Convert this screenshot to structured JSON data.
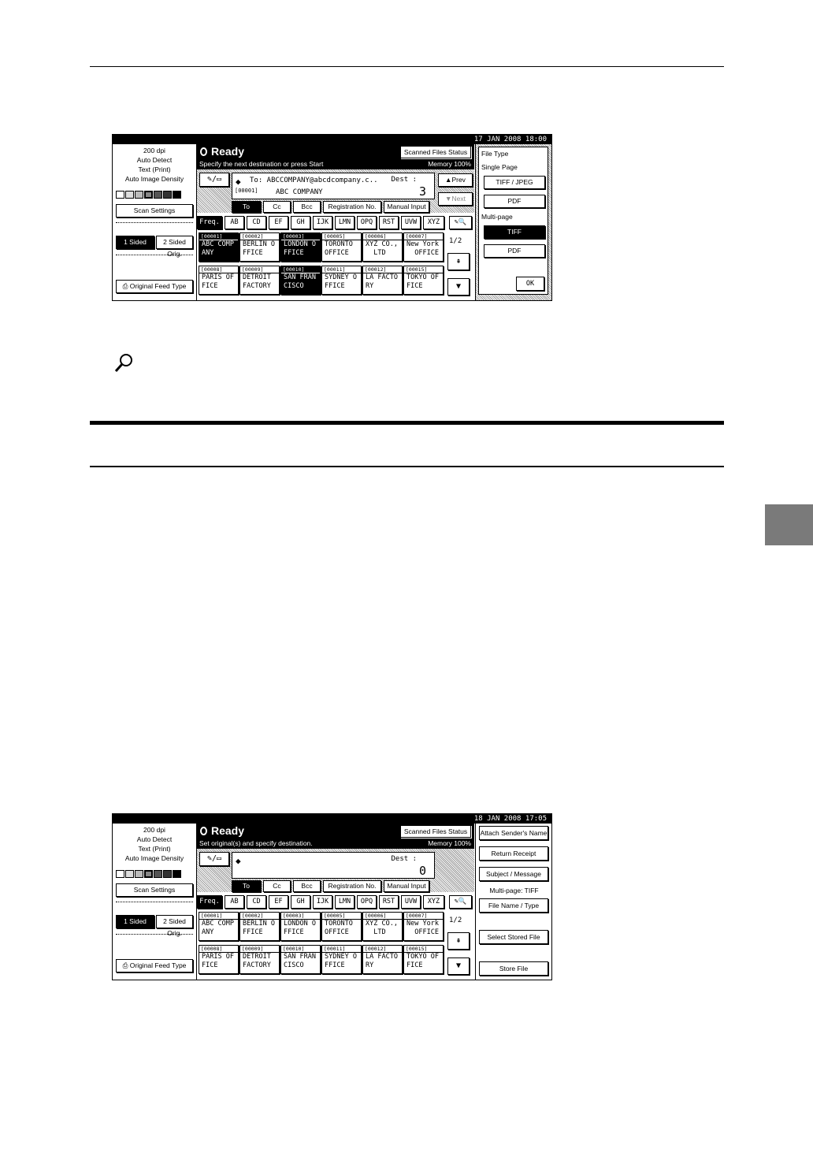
{
  "panel1": {
    "datetime": "17  JAN   2008 18:00",
    "left": {
      "resolution": "200 dpi",
      "detect": "Auto Detect",
      "mode": "Text (Print)",
      "density": "Auto Image Density",
      "scan_settings": "Scan Settings",
      "sided1": "1 Sided Orig.",
      "sided2": "2 Sided Orig.",
      "feed_type": "Original Feed Type"
    },
    "status": "Ready",
    "message": "Specify the next destination or press Start",
    "memory": "Memory 100%",
    "scanned_files_status": "Scanned Files Status",
    "dest_label": "Dest :",
    "dest_count": "3",
    "to_address": "To:   ABCCOMPANY@abcdcompany.c..",
    "entry_id": "[00001]",
    "entry_name": "ABC COMPANY",
    "prev": "▲Prev",
    "next": "▼Next",
    "tabs": {
      "to": "To",
      "cc": "Cc",
      "bcc": "Bcc",
      "reg": "Registration No.",
      "manual": "Manual Input"
    },
    "page": "1/2",
    "right": {
      "file_type": "File Type",
      "single_page": "Single Page",
      "tiff_jpeg": "TIFF / JPEG",
      "pdf1": "PDF",
      "multi_page": "Multi-page",
      "tiff": "TIFF",
      "pdf2": "PDF",
      "ok": "OK"
    }
  },
  "panel2": {
    "datetime": "18  JAN   2008 17:05",
    "left": {
      "resolution": "200 dpi",
      "detect": "Auto Detect",
      "mode": "Text (Print)",
      "density": "Auto Image Density",
      "scan_settings": "Scan Settings",
      "sided1": "1 Sided Orig.",
      "sided2": "2 Sided Orig.",
      "feed_type": "Original Feed Type"
    },
    "status": "Ready",
    "message": "Set original(s) and specify destination.",
    "memory": "Memory 100%",
    "scanned_files_status": "Scanned Files Status",
    "dest_label": "Dest :",
    "dest_count": "0",
    "tabs": {
      "to": "To",
      "cc": "Cc",
      "bcc": "Bcc",
      "reg": "Registration No.",
      "manual": "Manual Input"
    },
    "page": "1/2",
    "right": {
      "attach_sender": "Attach Sender's Name",
      "return_receipt": "Return Receipt",
      "subject_message": "Subject / Message",
      "multipage_tiff": "Multi-page: TIFF",
      "file_name_type": "File Name / Type",
      "select_stored": "Select Stored File",
      "store_file": "Store File"
    }
  },
  "index_tabs": [
    "Freq.",
    "AB",
    "CD",
    "EF",
    "GH",
    "IJK",
    "LMN",
    "OPQ",
    "RST",
    "UVW",
    "XYZ"
  ],
  "destinations": [
    {
      "id": "[00001]",
      "name": "ABC COMP\nANY"
    },
    {
      "id": "[00002]",
      "name": "BERLIN O\nFFICE"
    },
    {
      "id": "[00003]",
      "name": "LONDON O\nFFICE"
    },
    {
      "id": "[00005]",
      "name": "TORONTO\nOFFICE"
    },
    {
      "id": "[00006]",
      "name": "XYZ CO.,\n  LTD"
    },
    {
      "id": "[00007]",
      "name": "New York\n  OFFICE"
    },
    {
      "id": "[00008]",
      "name": "PARIS OF\nFICE"
    },
    {
      "id": "[00009]",
      "name": "DETROIT\nFACTORY"
    },
    {
      "id": "[00010]",
      "name": "SAN FRAN\nCISCO"
    },
    {
      "id": "[00011]",
      "name": "SYDNEY O\nFFICE"
    },
    {
      "id": "[00012]",
      "name": "LA FACTO\nRY"
    },
    {
      "id": "[00015]",
      "name": "TOKYO OF\nFICE"
    }
  ]
}
